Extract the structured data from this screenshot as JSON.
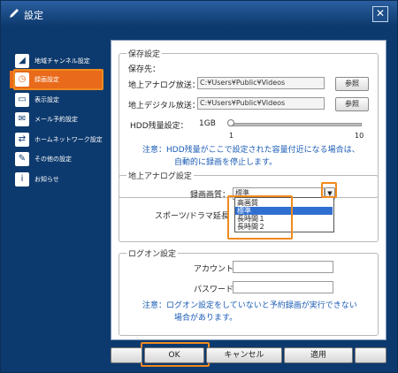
{
  "window": {
    "title": "設定",
    "close_label": "✕"
  },
  "sidebar": {
    "items": [
      {
        "label": "地域チャンネル設定",
        "icon": "antenna-icon",
        "glyph": "◢",
        "selected": false
      },
      {
        "label": "録画設定",
        "icon": "record-clock-icon",
        "glyph": "◷",
        "selected": true
      },
      {
        "label": "表示設定",
        "icon": "display-icon",
        "glyph": "▭",
        "selected": false
      },
      {
        "label": "メール予約設定",
        "icon": "mail-icon",
        "glyph": "✉",
        "selected": false
      },
      {
        "label": "ホームネットワーク設定",
        "icon": "network-icon",
        "glyph": "⇄",
        "selected": false
      },
      {
        "label": "その他の設定",
        "icon": "wrench-icon",
        "glyph": "✎",
        "selected": false
      },
      {
        "label": "お知らせ",
        "icon": "info-icon",
        "glyph": "i",
        "selected": false
      }
    ]
  },
  "storage": {
    "legend": "保存設定",
    "dest_label": "保存先：",
    "analog_label": "地上アナログ放送：",
    "analog_path": "C:¥Users¥Public¥Videos",
    "digital_label": "地上デジタル放送：",
    "digital_path": "C:¥Users¥Public¥Videos",
    "browse_label": "参照",
    "hdd_label": "HDD残量設定：",
    "hdd_value": "1GB",
    "slider_min": "1",
    "slider_max": "10",
    "slider_level": 0.0,
    "note_line1": "注意：HDD残量がここで設定された容量付近になる場合は、",
    "note_line2": "自動的に録画を停止します。"
  },
  "analog": {
    "legend": "地上アナログ設定",
    "quality_label": "録画画質：",
    "quality_value": "標準",
    "sports_label": "スポーツ/ドラマ延長",
    "options": [
      "高画質",
      "標準",
      "長時間１",
      "長時間２"
    ],
    "selected_index": 1
  },
  "logon": {
    "legend": "ログオン設定",
    "account_label": "アカウント：",
    "account_value": "",
    "password_label": "パスワード：",
    "password_value": "",
    "note_line1": "注意：ログオン設定をしていないと予約録画が実行できない",
    "note_line2": "場合があります。"
  },
  "footer": {
    "ok_label": "OK",
    "cancel_label": "キャンセル",
    "apply_label": "適用"
  },
  "colors": {
    "frame": "#0d3a6e",
    "highlight": "#f08a1e",
    "selected": "#e86a1a",
    "note": "#1a5bb5"
  }
}
